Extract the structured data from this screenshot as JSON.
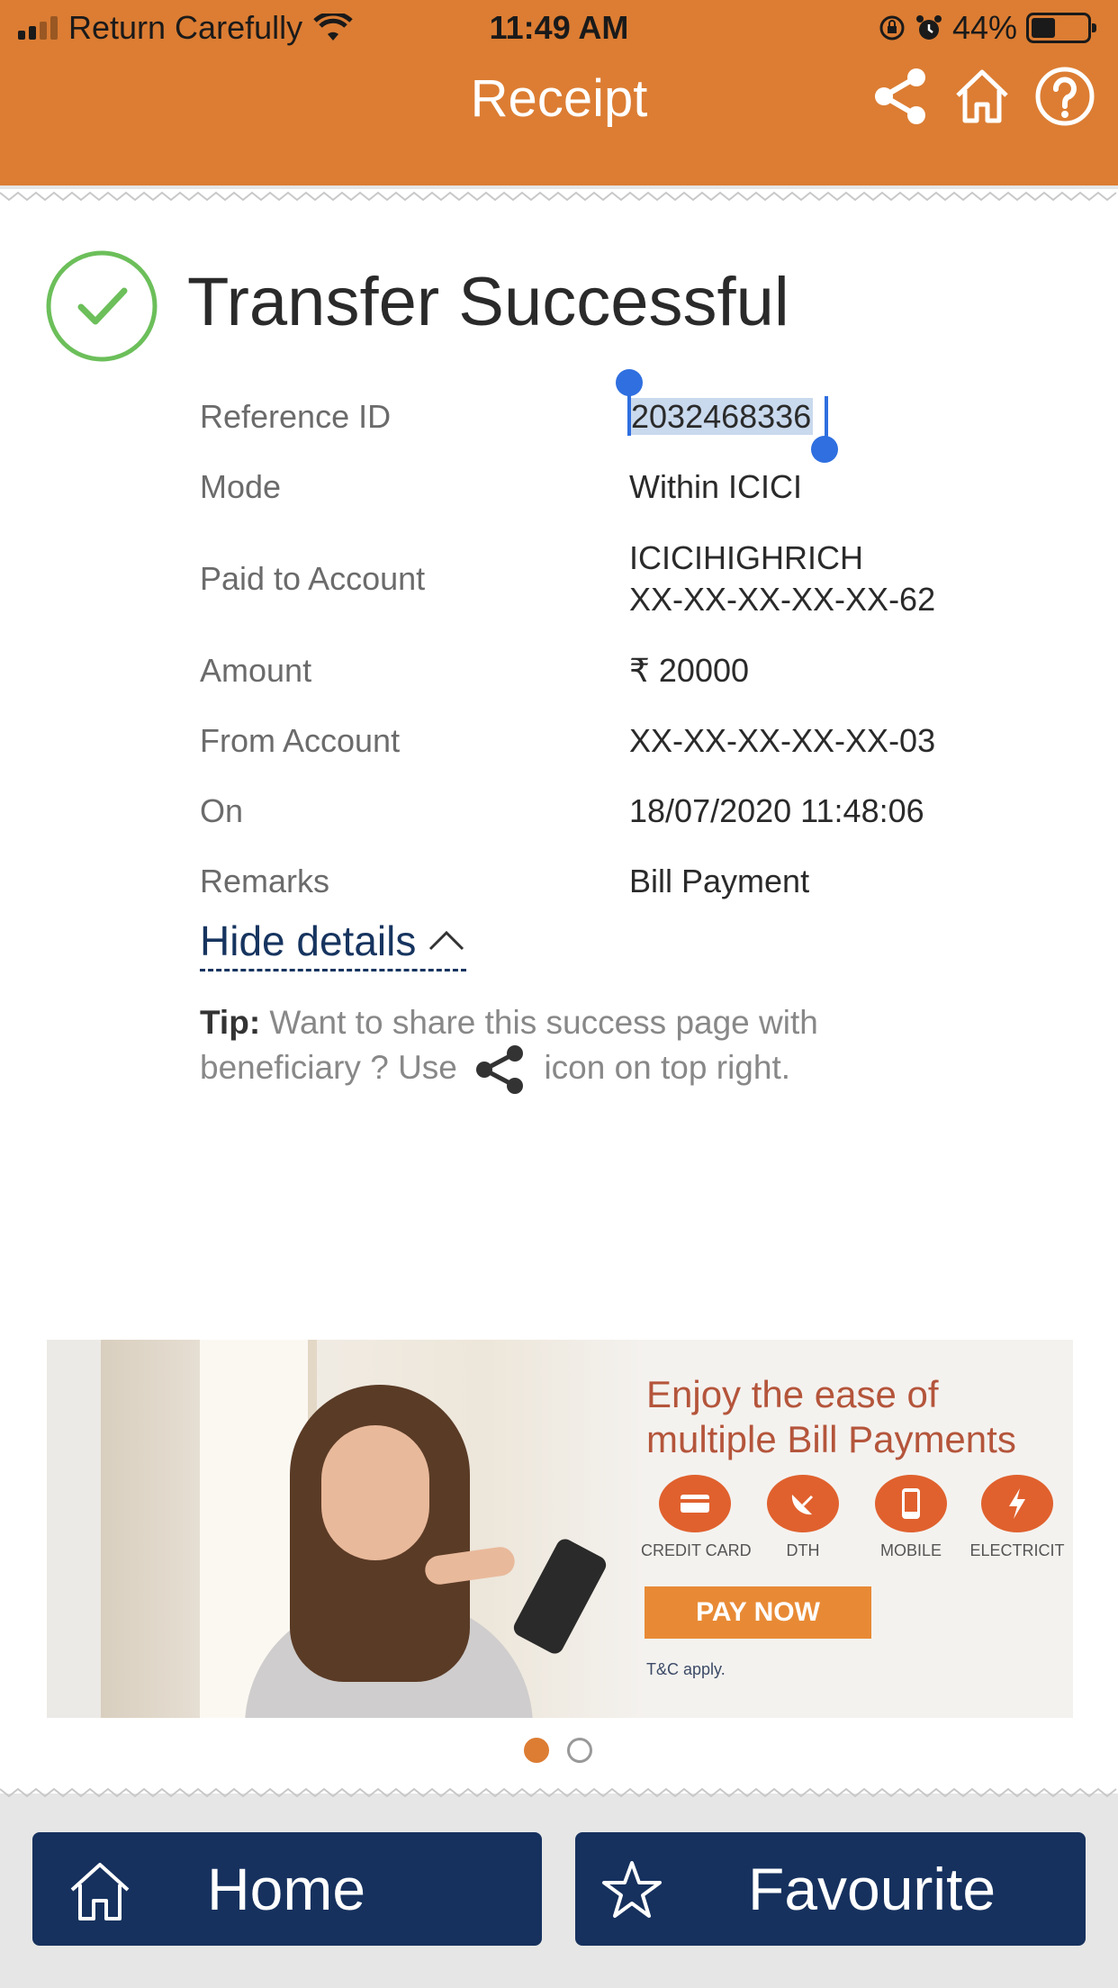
{
  "status_bar": {
    "carrier": "Return Carefully",
    "time": "11:49 AM",
    "battery": "44%"
  },
  "header": {
    "title": "Receipt",
    "icons": [
      "share-icon",
      "home-icon",
      "help-icon"
    ]
  },
  "result": {
    "title": "Transfer Successful"
  },
  "details": [
    {
      "label": "Reference ID",
      "value": "2032468336"
    },
    {
      "label": "Mode",
      "value": "Within ICICI"
    },
    {
      "label": "Paid to Account",
      "value": "ICICIHIGHRICH",
      "value2": "XX-XX-XX-XX-XX-62"
    },
    {
      "label": "Amount",
      "value": "₹ 20000"
    },
    {
      "label": "From Account",
      "value": "XX-XX-XX-XX-XX-03"
    },
    {
      "label": "On",
      "value": "18/07/2020 11:48:06"
    },
    {
      "label": "Remarks",
      "value": "Bill Payment"
    }
  ],
  "hide_details": "Hide details",
  "tip": {
    "label": "Tip:",
    "text_before": "Want to share this success page with beneficiary ? Use",
    "text_after": "icon on top right."
  },
  "banner": {
    "title_line1": "Enjoy the ease of",
    "title_line2": "multiple Bill Payments",
    "categories": [
      "CREDIT CARD",
      "DTH",
      "MOBILE",
      "ELECTRICIT"
    ],
    "cta": "PAY NOW",
    "terms": "T&C apply."
  },
  "buttons": {
    "home": "Home",
    "favourite": "Favourite"
  },
  "colors": {
    "header": "#dc7d33",
    "button": "#16315e",
    "success": "#6cbf5a"
  }
}
